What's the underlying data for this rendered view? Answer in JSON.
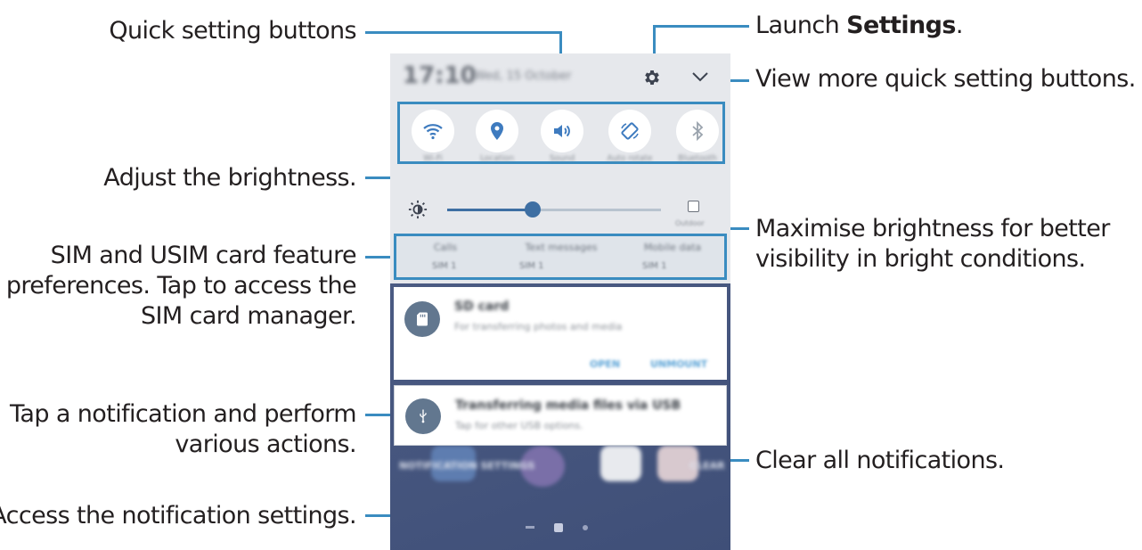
{
  "callouts": {
    "quick_setting_buttons": "Quick setting buttons",
    "launch_settings_prefix": "Launch ",
    "launch_settings_bold": "Settings",
    "launch_settings_suffix": ".",
    "view_more": "View more quick setting buttons.",
    "adjust_brightness": "Adjust the brightness.",
    "maximise_line1": "Maximise brightness for better",
    "maximise_line2": "visibility in bright conditions.",
    "sim_line1": "SIM and USIM card feature",
    "sim_line2": "preferences. Tap to access the",
    "sim_line3": "SIM card manager.",
    "tap_notif_line1": "Tap a notification and perform",
    "tap_notif_line2": "various actions.",
    "clear_all": "Clear all notifications.",
    "access_settings": "Access the notification settings."
  },
  "status_bar": {
    "time": "17:10",
    "date": "Wed, 15 October"
  },
  "quick_settings": [
    {
      "icon": "wifi-icon",
      "label": "Wi-Fi"
    },
    {
      "icon": "location-icon",
      "label": "Location"
    },
    {
      "icon": "sound-icon",
      "label": "Sound"
    },
    {
      "icon": "rotation-icon",
      "label": "Auto rotate"
    },
    {
      "icon": "bluetooth-icon",
      "label": "Bluetooth"
    }
  ],
  "brightness": {
    "level_percent": 40,
    "outdoor_label": "Outdoor"
  },
  "sim": [
    {
      "title": "Calls",
      "sub": "SIM 1"
    },
    {
      "title": "Text messages",
      "sub": "SIM 1"
    },
    {
      "title": "Mobile data",
      "sub": "SIM 1"
    }
  ],
  "notifications": [
    {
      "icon": "sd-card-icon",
      "title": "SD card",
      "subtitle": "For transferring photos and media",
      "actions": [
        "OPEN",
        "UNMOUNT"
      ]
    },
    {
      "icon": "usb-icon",
      "title": "Transferring media files via USB",
      "subtitle": "Tap for other USB options."
    }
  ],
  "footer": {
    "notif_settings": "NOTIFICATION SETTINGS",
    "clear": "CLEAR"
  },
  "colors": {
    "accent": "#3a8cc0",
    "panel": "#e6e8ec",
    "icon_blue": "#3e6fa3"
  }
}
